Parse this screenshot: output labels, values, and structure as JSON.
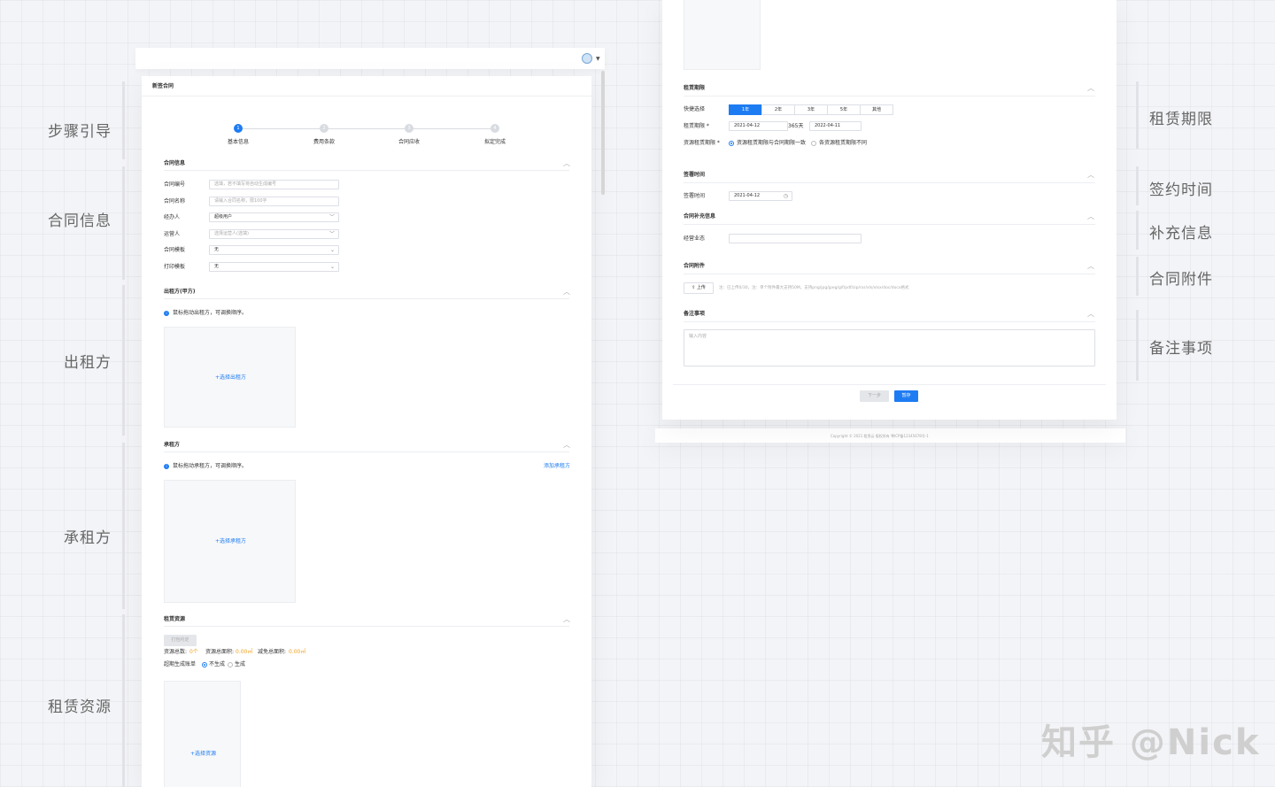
{
  "left_labels": [
    "步骤引导",
    "合同信息",
    "出租方",
    "承租方",
    "租赁资源"
  ],
  "right_labels": [
    "租赁期限",
    "签约时间",
    "补充信息",
    "合同附件",
    "备注事项"
  ],
  "form": {
    "page_title": "新签合同",
    "steps": [
      "基本信息",
      "费用条款",
      "合同应收",
      "拟定完成"
    ],
    "contract_info": {
      "title": "合同信息",
      "fields": [
        {
          "label": "合同编号",
          "value": "",
          "placeholder": "选填，若不填写将自动生成编号"
        },
        {
          "label": "合同名称",
          "value": "",
          "placeholder": "请输入合同名称，限100字"
        },
        {
          "label": "经办人",
          "value": "超级用户",
          "placeholder": ""
        },
        {
          "label": "运营人",
          "value": "",
          "placeholder": "选择运营人(选填)"
        },
        {
          "label": "合同模板",
          "value": "无",
          "placeholder": ""
        },
        {
          "label": "打印模板",
          "value": "无",
          "placeholder": ""
        }
      ]
    },
    "lessor": {
      "title": "出租方(甲方)",
      "hint": "鼠标拖动出租方，可调换顺序。",
      "drop": "+选择出租方"
    },
    "lessee": {
      "title": "承租方",
      "hint": "鼠标拖动承租方，可调换顺序。",
      "add_link": "添加承租方",
      "drop": "+选择承租方"
    },
    "resources": {
      "title": "租赁资源",
      "pack_button": "打包约定",
      "total_label": "资源总数:",
      "total_value": "0个",
      "area_label": "资源总面积:",
      "area_value": "0.00㎡",
      "reduced_label": "减免总面积:",
      "reduced_value": "0.00㎡",
      "overdue_label": "超期生成账单",
      "opt_no": "不生成",
      "opt_yes": "生成",
      "drop": "+选择资源"
    }
  },
  "right_form": {
    "lease_term": {
      "title": "租赁期限",
      "quick_label": "快捷选择",
      "quick_options": [
        "1年",
        "2年",
        "3年",
        "5年",
        "其他"
      ],
      "period_label": "租赁期限 *",
      "start": "2021-04-12",
      "days": "365天",
      "end": "2022-04-11",
      "resource_label": "资源租赁期限 *",
      "opt_same": "资源租赁期限与合同期限一致",
      "opt_diff": "各资源租赁期限不同"
    },
    "signing": {
      "title": "签署时间",
      "label": "签署时间",
      "value": "2021-04-12"
    },
    "supplement": {
      "title": "合同补充信息",
      "label": "经营业态"
    },
    "attachment": {
      "title": "合同附件",
      "upload": "上传",
      "note": "注：已上传0/30，注：单个附件最大支持50M，支持png/jpg/jpeg/gif/pdf/zip/rar/xls/xlsx/doc/docx格式"
    },
    "remarks": {
      "title": "备注事项",
      "placeholder": "输入内容"
    },
    "buttons": {
      "prev": "下一步",
      "save": "暂存"
    },
    "footer": "Copyright © 2021 租赁云 版权所有 粤ICP备12345678号-1"
  },
  "watermark": "知乎 @Nick"
}
